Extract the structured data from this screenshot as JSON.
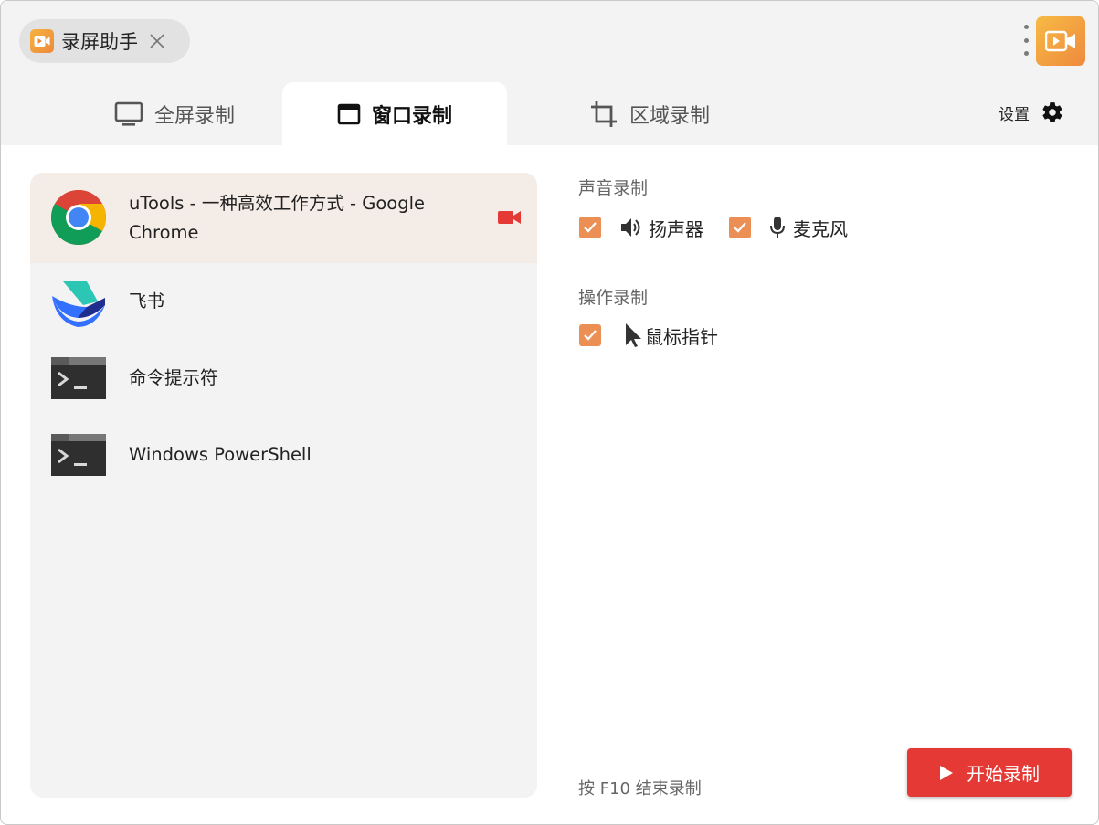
{
  "app": {
    "name": "录屏助手"
  },
  "tabs": [
    {
      "label": "全屏录制",
      "icon": "monitor-icon",
      "active": false
    },
    {
      "label": "窗口录制",
      "icon": "window-icon",
      "active": true
    },
    {
      "label": "区域录制",
      "icon": "crop-icon",
      "active": false
    }
  ],
  "settings": {
    "label": "设置"
  },
  "windows": [
    {
      "title": "uTools - 一种高效工作方式 - Google Chrome",
      "icon": "chrome-icon",
      "selected": true
    },
    {
      "title": "飞书",
      "icon": "feishu-icon",
      "selected": false
    },
    {
      "title": "命令提示符",
      "icon": "terminal-icon",
      "selected": false
    },
    {
      "title": "Windows PowerShell",
      "icon": "terminal-icon",
      "selected": false
    }
  ],
  "audio": {
    "title": "声音录制",
    "speaker": {
      "label": "扬声器",
      "checked": true
    },
    "mic": {
      "label": "麦克风",
      "checked": true
    }
  },
  "operation": {
    "title": "操作录制",
    "cursor": {
      "label": "鼠标指针",
      "checked": true
    }
  },
  "hint": "按 F10 结束录制",
  "start_button": {
    "label": "开始录制"
  },
  "colors": {
    "accent": "#ec8f55",
    "record_red": "#e53935",
    "selected_row": "#f4ece6"
  }
}
